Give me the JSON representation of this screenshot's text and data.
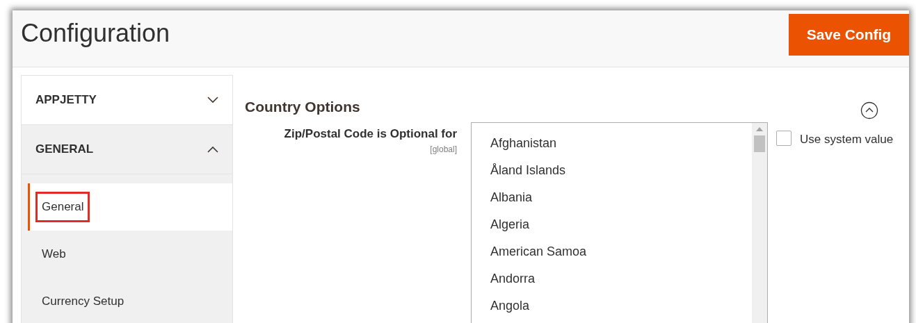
{
  "page_title": "Configuration",
  "save_button": "Save Config",
  "sidebar": [
    {
      "label": "APPJETTY",
      "expanded": false
    },
    {
      "label": "GENERAL",
      "expanded": true,
      "items": [
        {
          "label": "General",
          "selected": true,
          "highlighted": true
        },
        {
          "label": "Web",
          "selected": false,
          "highlighted": false
        },
        {
          "label": "Currency Setup",
          "selected": false,
          "highlighted": false
        }
      ]
    }
  ],
  "section": {
    "title": "Country Options",
    "expanded": true,
    "field": {
      "label": "Zip/Postal Code is Optional for",
      "scope": "[global]",
      "options": [
        "Afghanistan",
        "Åland Islands",
        "Albania",
        "Algeria",
        "American Samoa",
        "Andorra",
        "Angola"
      ],
      "use_system_value": {
        "label": "Use system value",
        "checked": false
      }
    }
  }
}
